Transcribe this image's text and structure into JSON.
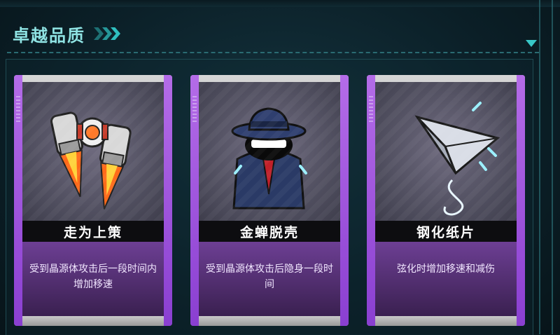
{
  "section": {
    "title": "卓越品质"
  },
  "cards": [
    {
      "name": "走为上策",
      "description": "受到晶源体攻击后一段时间内增加移速",
      "icon": "jetpack-icon"
    },
    {
      "name": "金蝉脱壳",
      "description": "受到晶源体攻击后隐身一段时间",
      "icon": "hat-spy-icon"
    },
    {
      "name": "钢化纸片",
      "description": "弦化时增加移速和减伤",
      "icon": "paper-plane-icon"
    }
  ],
  "colors": {
    "accent": "#38c8c8",
    "title": "#8fe3e3",
    "card_frame": "#a352e0",
    "desc_bg": "#5b3680"
  }
}
